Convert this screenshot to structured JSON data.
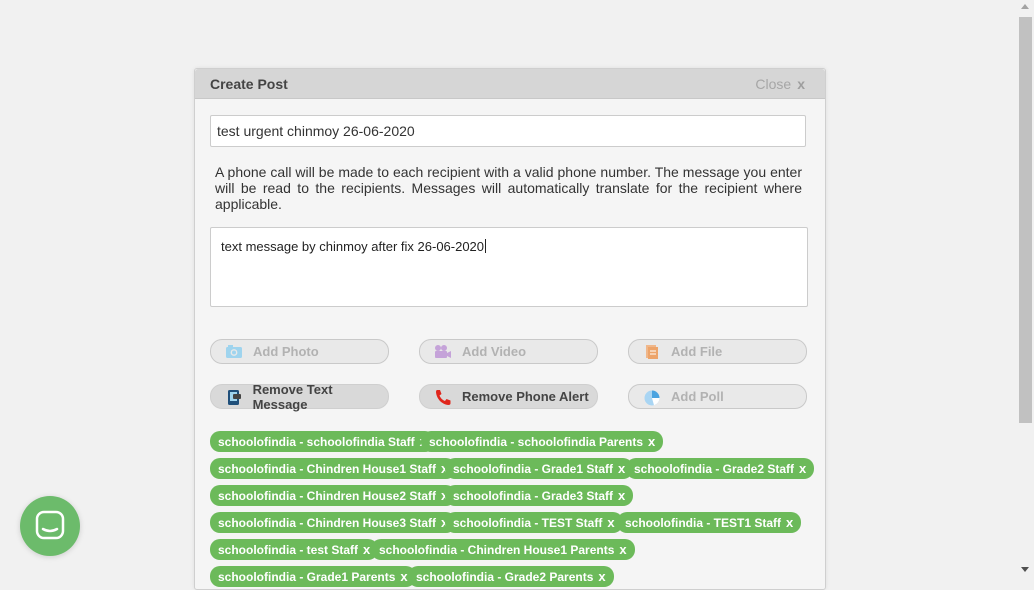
{
  "modal": {
    "title": "Create Post",
    "close_label": "Close",
    "close_icon": "x"
  },
  "subject": {
    "value": "test urgent chinmoy 26-06-2020"
  },
  "info_text": "A phone call will be made to each recipient with a valid phone number. The message you enter will be read to the recipients. Messages will automatically translate for the recipient where applicable.",
  "message": {
    "value": "text message by chinmoy after fix 26-06-2020"
  },
  "actions": [
    {
      "label": "Add Photo",
      "icon": "camera-icon",
      "active": false
    },
    {
      "label": "Add Video",
      "icon": "video-camera-icon",
      "active": false
    },
    {
      "label": "Add File",
      "icon": "file-icon",
      "active": false
    },
    {
      "label": "Remove Text Message",
      "icon": "phone-message-icon",
      "active": true
    },
    {
      "label": "Remove Phone Alert",
      "icon": "phone-icon",
      "active": true
    },
    {
      "label": "Add Poll",
      "icon": "pie-chart-icon",
      "active": false
    }
  ],
  "tag_remove_label": "x",
  "recipients": [
    "schoolofindia - schoolofindia Staff",
    "schoolofindia - schoolofindia Parents",
    "schoolofindia - Chindren House1 Staff",
    "schoolofindia - Grade1 Staff",
    "schoolofindia - Grade2 Staff",
    "schoolofindia - Chindren House2 Staff",
    "schoolofindia - Grade3 Staff",
    "schoolofindia - Chindren House3 Staff",
    "schoolofindia - TEST Staff",
    "schoolofindia - TEST1 Staff",
    "schoolofindia - test Staff",
    "schoolofindia - Chindren House1 Parents",
    "schoolofindia - Grade1 Parents",
    "schoolofindia - Grade2 Parents"
  ],
  "colors": {
    "tag_green": "#6cba5a",
    "chat_launcher": "#6cbb6b",
    "phone_red": "#e0261c",
    "poll_blue": "#4aa3e0"
  },
  "chat_launcher": {
    "icon": "chat-bubble-icon"
  }
}
